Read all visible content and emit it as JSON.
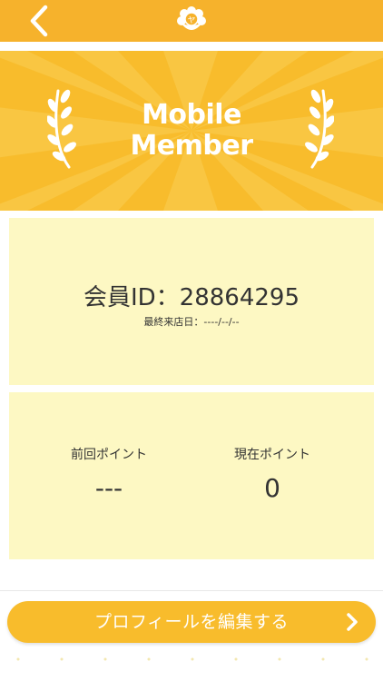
{
  "header": {
    "back_icon": "chevron-left-icon",
    "logo_icon": "flower-logo-icon",
    "logo_text": "ヤ"
  },
  "banner": {
    "title_line1": "Mobile",
    "title_line2": "Member",
    "color": "#f8bc2c",
    "laurel_icon": "laurel-icon"
  },
  "member": {
    "id_text": "会員ID：28864295",
    "last_visit": "最終来店日：----/--/--"
  },
  "points": {
    "previous_label": "前回ポイント",
    "previous_value": "---",
    "current_label": "現在ポイント",
    "current_value": "0"
  },
  "footer": {
    "edit_profile_label": "プロフィールを編集する",
    "chevron_icon": "chevron-right-icon"
  },
  "colors": {
    "accent": "#f6b22c",
    "card": "#fdf8c3",
    "text": "#333333"
  }
}
